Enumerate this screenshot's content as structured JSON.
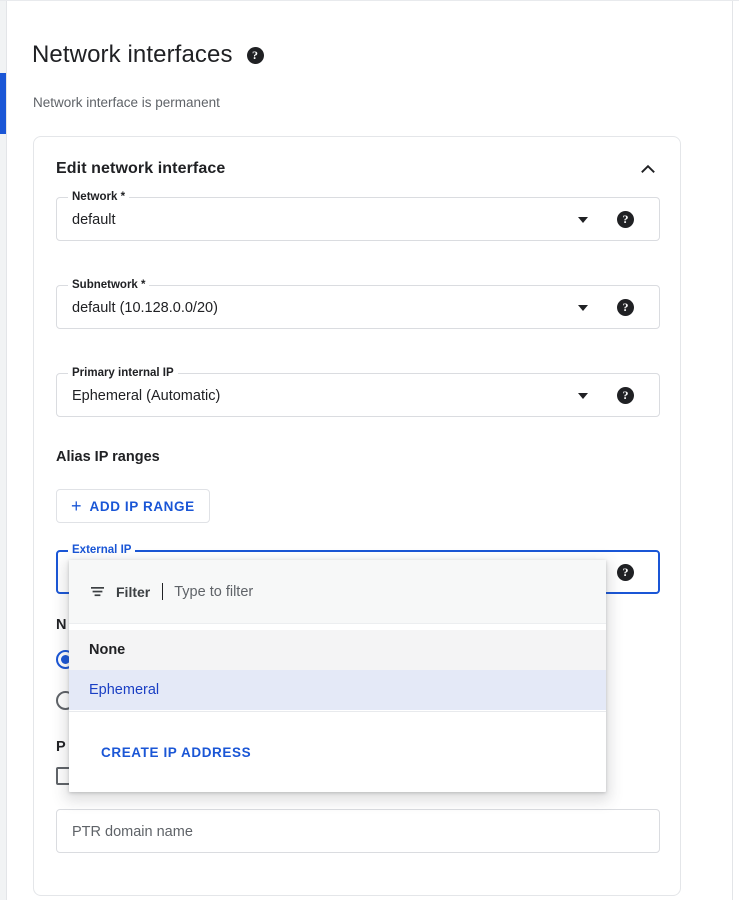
{
  "page": {
    "title": "Network interfaces",
    "title_help_icon": "help-icon",
    "subtitle": "Network interface is permanent"
  },
  "card": {
    "title": "Edit network interface",
    "collapse_icon": "chevron-up-icon",
    "fields": [
      {
        "legend": "Network *",
        "value": "default",
        "caret_icon": "chevron-down-icon",
        "help_icon": "help-icon"
      },
      {
        "legend": "Subnetwork *",
        "value": "default (10.128.0.0/20)",
        "caret_icon": "chevron-down-icon",
        "help_icon": "help-icon"
      },
      {
        "legend": "Primary internal IP",
        "value": "Ephemeral (Automatic)",
        "caret_icon": "chevron-down-icon",
        "help_icon": "help-icon"
      }
    ],
    "alias_ip_ranges": {
      "label": "Alias IP ranges",
      "add_button": {
        "plus_icon": "plus-icon",
        "label": "ADD IP RANGE"
      }
    },
    "external_ip": {
      "legend": "External IP",
      "help_icon": "help-icon"
    },
    "network_service_tier": {
      "label": "N",
      "options": [
        {
          "label": "",
          "selected": true
        },
        {
          "label": "",
          "selected": false
        }
      ]
    },
    "public_ptr": {
      "label": "P",
      "checkbox_label": "",
      "checked": false,
      "domain_input_placeholder": "PTR domain name"
    }
  },
  "dropdown": {
    "filter": {
      "icon": "filter-icon",
      "label": "Filter",
      "placeholder": "Type to filter",
      "value": ""
    },
    "options": [
      {
        "label": "None",
        "state": "hovered"
      },
      {
        "label": "Ephemeral",
        "state": "selected"
      }
    ],
    "action": {
      "label": "CREATE IP ADDRESS"
    }
  },
  "colors": {
    "accent_blue": "#1a56d6",
    "selected_row_bg": "#e4e9f7",
    "hover_row_bg": "#f4f4f5",
    "text_primary": "#202124",
    "text_secondary": "#5f6368",
    "border": "#dadce0"
  },
  "scrollbar": {
    "orientation": "vertical",
    "position": "left"
  }
}
